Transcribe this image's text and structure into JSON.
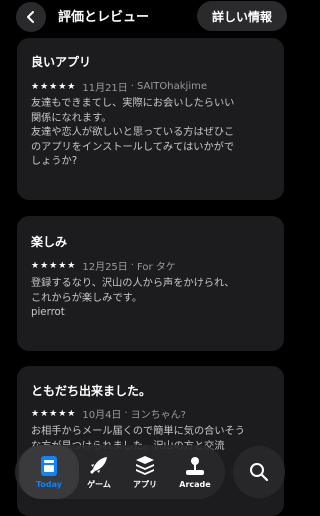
{
  "header": {
    "title": "評価とレビュー",
    "detail_button": "詳しい情報"
  },
  "reviews": [
    {
      "title": "良いアプリ",
      "stars": "★★★★★",
      "date": "11月21日",
      "author": "SAITOhakjime",
      "body": [
        "友達もできまてし、実際にお会いしたらいい",
        "関係になれます。",
        "友達や恋人が欲しいと思っている方はぜひこ",
        "のアプリをインストールしてみてはいかがで",
        "しょうか?"
      ]
    },
    {
      "title": "楽しみ",
      "stars": "★★★★★",
      "date": "12月25日",
      "author": "For タケ",
      "body": [
        "登録するなり、沢山の人から声をかけられ、",
        "これからが楽しみです。",
        "pierrot"
      ]
    },
    {
      "title": "ともだち出来ました。",
      "stars": "★★★★★",
      "date": "10月4日",
      "author": "ヨンちゃん?",
      "body": [
        "お相手からメール届くので簡単に気の合いそう",
        "な方が見つけられました。沢山の方と交流"
      ]
    }
  ],
  "meta_separator": "·",
  "tabbar": {
    "tabs": [
      {
        "label": "Today",
        "icon": "today-icon",
        "active": true
      },
      {
        "label": "ゲーム",
        "icon": "rocket-icon",
        "active": false
      },
      {
        "label": "アプリ",
        "icon": "layers-icon",
        "active": false
      },
      {
        "label": "Arcade",
        "icon": "joystick-icon",
        "active": false
      }
    ],
    "search_icon": "search-icon"
  },
  "colors": {
    "background": "#000000",
    "card": "#1c1c1e",
    "accent": "#0a84ff",
    "secondary_text": "#9a9a9e"
  }
}
